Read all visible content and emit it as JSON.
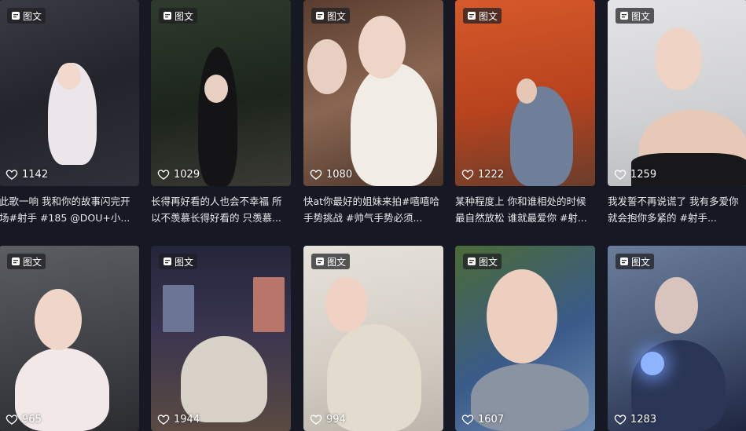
{
  "badge_label": "图文",
  "cards": [
    {
      "likes": "1142",
      "caption": "此歌一响 我和你的故事闪完开场#射手 #185 @DOU+小...",
      "bg": "#2a2b33",
      "accent": "#e8e3e6"
    },
    {
      "likes": "1029",
      "caption": "长得再好看的人也会不幸福 所以不羡慕长得好看的 只羡慕...",
      "bg": "#243126",
      "accent": "#1b1b1f"
    },
    {
      "likes": "1080",
      "caption": "快at你最好的姐妹来拍#嘻嘻哈手势挑战 #帅气手势必须...",
      "bg": "#6b4a3c",
      "accent": "#f2ede8"
    },
    {
      "likes": "1222",
      "caption": "某种程度上 你和谁相处的时候最自然放松 谁就最爱你 #射...",
      "bg": "#c34a23",
      "accent": "#7b8aa6"
    },
    {
      "likes": "1259",
      "caption": "我发誓不再说谎了 我有多爱你就会抱你多紧的 #射手...",
      "bg": "#d6d6d8",
      "accent": "#1a1a1c"
    },
    {
      "likes": "965",
      "caption": "",
      "bg": "#4c4e52",
      "accent": "#f1e6e6"
    },
    {
      "likes": "1944",
      "caption": "",
      "bg": "#2d2c3e",
      "accent": "#d9d5cf"
    },
    {
      "likes": "994",
      "caption": "",
      "bg": "#d8d3cc",
      "accent": "#e7e1d6"
    },
    {
      "likes": "1607",
      "caption": "",
      "bg": "#3e5a2e",
      "accent": "#8a8f9c"
    },
    {
      "likes": "1283",
      "caption": "",
      "bg": "#5b6f8c",
      "accent": "#2a3550"
    }
  ]
}
